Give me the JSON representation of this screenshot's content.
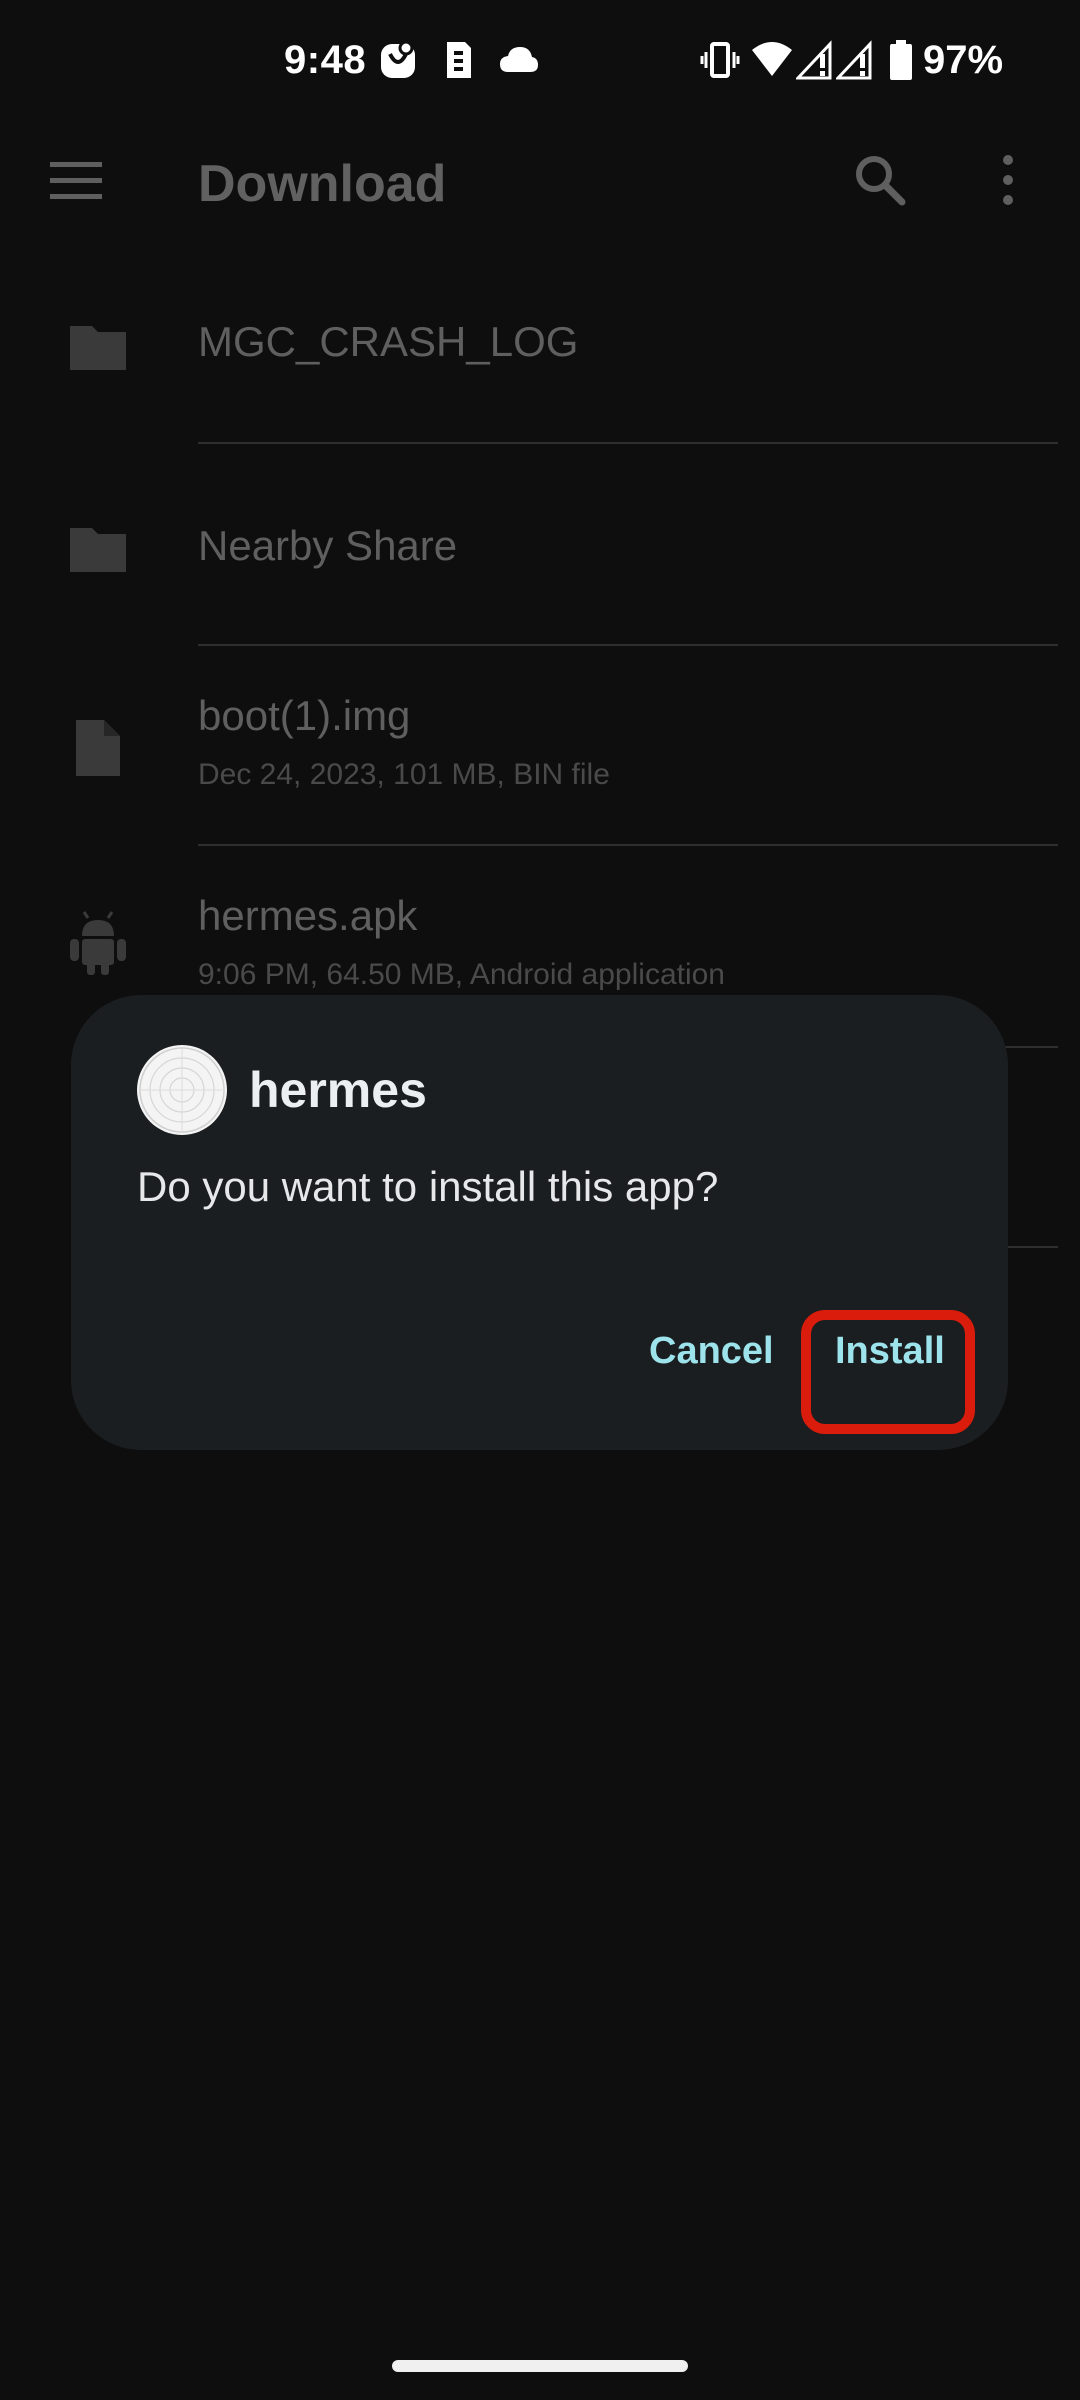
{
  "status_bar": {
    "time": "9:48",
    "battery": "97%",
    "icons": [
      "notification-badge-icon",
      "sim-card-icon",
      "cloud-icon",
      "vibrate-icon",
      "wifi-icon",
      "signal-icon",
      "signal-icon",
      "battery-icon"
    ]
  },
  "app_bar": {
    "title": "Download",
    "icons": [
      "menu-icon",
      "search-icon",
      "more-vert-icon"
    ]
  },
  "files": [
    {
      "name": "MGC_CRASH_LOG",
      "meta": "",
      "icon": "folder-icon"
    },
    {
      "name": "Nearby Share",
      "meta": "",
      "icon": "folder-icon"
    },
    {
      "name": "boot(1).img",
      "meta": "Dec 24, 2023, 101 MB, BIN file",
      "icon": "file-icon"
    },
    {
      "name": "hermes.apk",
      "meta": "9:06 PM, 64.50 MB, Android application",
      "icon": "android-icon"
    }
  ],
  "dialog": {
    "app_name": "hermes",
    "message": "Do you want to install this app?",
    "cancel_label": "Cancel",
    "install_label": "Install"
  },
  "colors": {
    "background": "#0e0e0e",
    "dialog_bg": "#1b1e20",
    "accent": "#9ce3ec",
    "highlight": "#d91c0b"
  }
}
